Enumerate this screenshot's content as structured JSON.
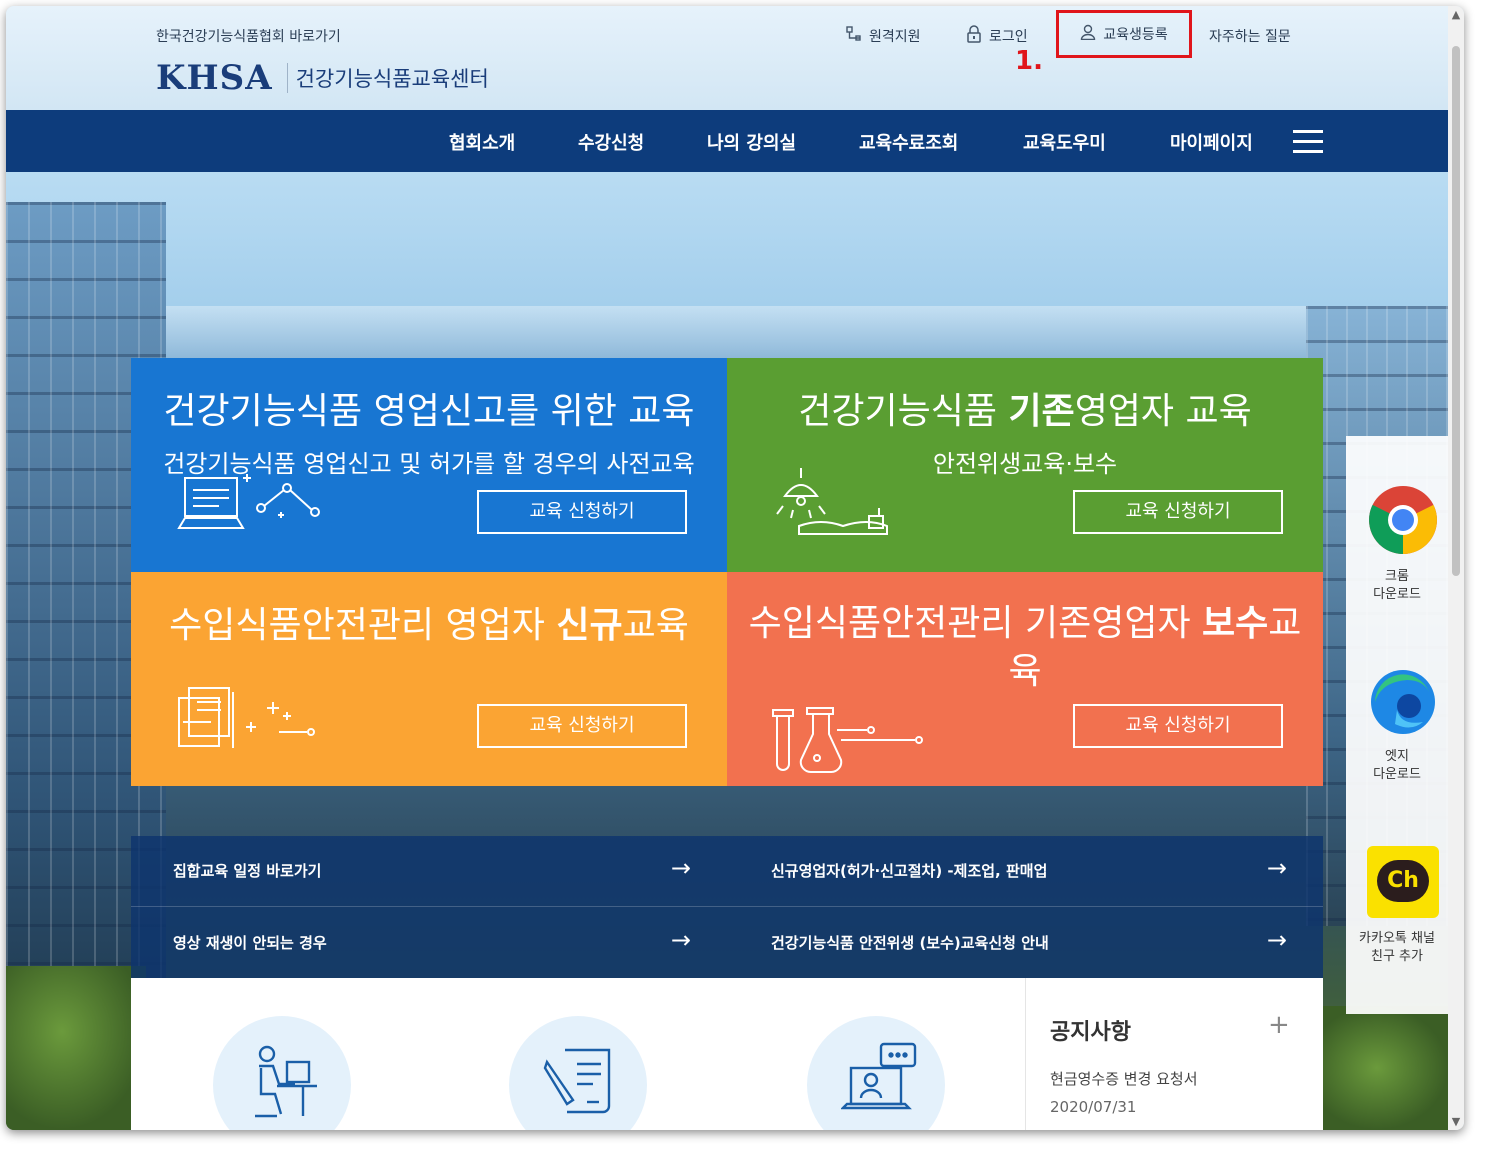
{
  "header": {
    "association_link": "한국건강기능식품협회 바로가기",
    "logo_text": "KHSA",
    "logo_sub": "건강기능식품교육센터",
    "util_links": {
      "remote": "원격지원",
      "login": "로그인",
      "register": "교육생등록",
      "faq": "자주하는 질문"
    },
    "step_label": "1."
  },
  "nav": {
    "items": [
      "협회소개",
      "수강신청",
      "나의 강의실",
      "교육수료조회",
      "교육도우미",
      "마이페이지"
    ]
  },
  "tiles": [
    {
      "title": "건강기능식품 영업신고를 위한 교육",
      "sub": "건강기능식품 영업신고 및 허가를 할 경우의 사전교육",
      "button": "교육 신청하기",
      "color": "#1876d2"
    },
    {
      "title_pre": "건강기능식품 ",
      "title_bold": "기존",
      "title_post": "영업자 교육",
      "sub": "안전위생교육·보수",
      "button": "교육 신청하기",
      "color": "#5a9e32"
    },
    {
      "title_pre": "수입식품안전관리 영업자 ",
      "title_bold": "신규",
      "title_post": "교육",
      "button": "교육 신청하기",
      "color": "#fba433"
    },
    {
      "title_pre": "수입식품안전관리 기존영업자 ",
      "title_bold": "보수",
      "title_post": "교육",
      "button": "교육 신청하기",
      "color": "#f2714f"
    }
  ],
  "quick_links": [
    {
      "label": "집합교육 일정 바로가기"
    },
    {
      "label": "신규영업자(허가·신고절차) -제조업, 판매업"
    },
    {
      "label": "영상 재생이 안되는 경우"
    },
    {
      "label": "건강기능식품 안전위생 (보수)교육신청 안내"
    }
  ],
  "notice": {
    "title": "공지사항",
    "more": "+",
    "item": "현금영수증 변경 요청서",
    "date": "2020/07/31"
  },
  "side_menu": {
    "chrome": [
      "크롬",
      "다운로드"
    ],
    "edge": [
      "엣지",
      "다운로드"
    ],
    "kakao": [
      "카카오톡 채널",
      "친구 추가"
    ],
    "kakao_icon_text": "Ch"
  },
  "icons": {
    "remote": "remote-support-icon",
    "login": "lock-icon",
    "register": "user-icon",
    "menu": "hamburger-icon",
    "arrow": "arrow-right-icon"
  },
  "colors": {
    "nav_bg": "#0d3c7c",
    "highlight": "#e0151b"
  }
}
